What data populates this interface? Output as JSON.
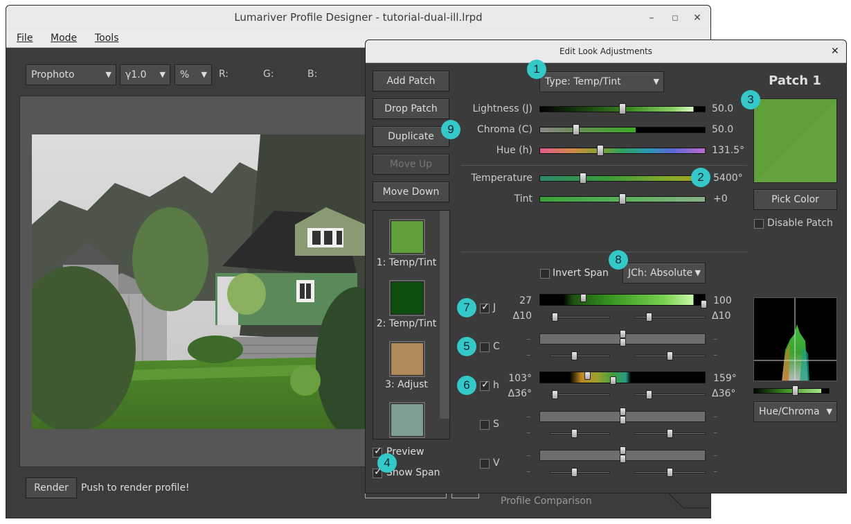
{
  "main_window": {
    "title": "Lumariver Profile Designer - tutorial-dual-ill.lrpd",
    "menu": [
      "File",
      "Mode",
      "Tools"
    ],
    "toolbar": {
      "colorspace": "Prophoto",
      "gamma": "γ1.0",
      "unit": "%",
      "r_label": "R:",
      "g_label": "G:",
      "b_label": "B:"
    },
    "render_button": "Render",
    "render_hint": "Push to render profile!",
    "bottom_tab": "Profile Comparison"
  },
  "dialog": {
    "title": "Edit Look Adjustments",
    "buttons": {
      "add_patch": "Add Patch",
      "drop_patch": "Drop Patch",
      "duplicate": "Duplicate",
      "move_up": "Move Up",
      "move_down": "Move Down"
    },
    "patches": [
      {
        "label": "1: Temp/Tint",
        "color": "#5fa03a"
      },
      {
        "label": "2: Temp/Tint",
        "color": "#0f4f0e"
      },
      {
        "label": "3: Adjust",
        "color": "#b08a5a"
      },
      {
        "label": "",
        "color": "#7e9e96"
      }
    ],
    "preview_label": "Preview",
    "show_span_label": "Show Span",
    "type_select": "Type: Temp/Tint",
    "sliders": [
      {
        "label": "Lightness (J)",
        "value": "50.0",
        "fraction": 0.5
      },
      {
        "label": "Chroma (C)",
        "value": "50.0",
        "fraction": 0.22
      },
      {
        "label": "Hue (h)",
        "value": "131.5°",
        "fraction": 0.365
      },
      {
        "label": "Temperature",
        "value": "5400°",
        "fraction": 0.26
      },
      {
        "label": "Tint",
        "value": "+0",
        "fraction": 0.5
      }
    ],
    "patch_panel": {
      "title": "Patch 1",
      "color": "#5fa03a",
      "pick_color": "Pick Color",
      "disable_patch": "Disable Patch",
      "histogram_select": "Hue/Chroma"
    },
    "span": {
      "invert_span": "Invert Span",
      "mode_select": "JCh: Absolute",
      "rows": [
        {
          "label": "J",
          "checked": true,
          "low": "27",
          "high": "100",
          "dlow": "Δ10",
          "dhigh": "Δ10"
        },
        {
          "label": "C",
          "checked": false,
          "low": "–",
          "high": "–",
          "dlow": "–",
          "dhigh": "–"
        },
        {
          "label": "h",
          "checked": true,
          "low": "103°",
          "high": "159°",
          "dlow": "Δ36°",
          "dhigh": "Δ36°"
        },
        {
          "label": "S",
          "checked": false,
          "low": "–",
          "high": "–",
          "dlow": "–",
          "dhigh": "–"
        },
        {
          "label": "V",
          "checked": false,
          "low": "–",
          "high": "–",
          "dlow": "–",
          "dhigh": "–"
        }
      ]
    },
    "badges": [
      "1",
      "2",
      "3",
      "4",
      "5",
      "6",
      "7",
      "8",
      "9"
    ]
  }
}
